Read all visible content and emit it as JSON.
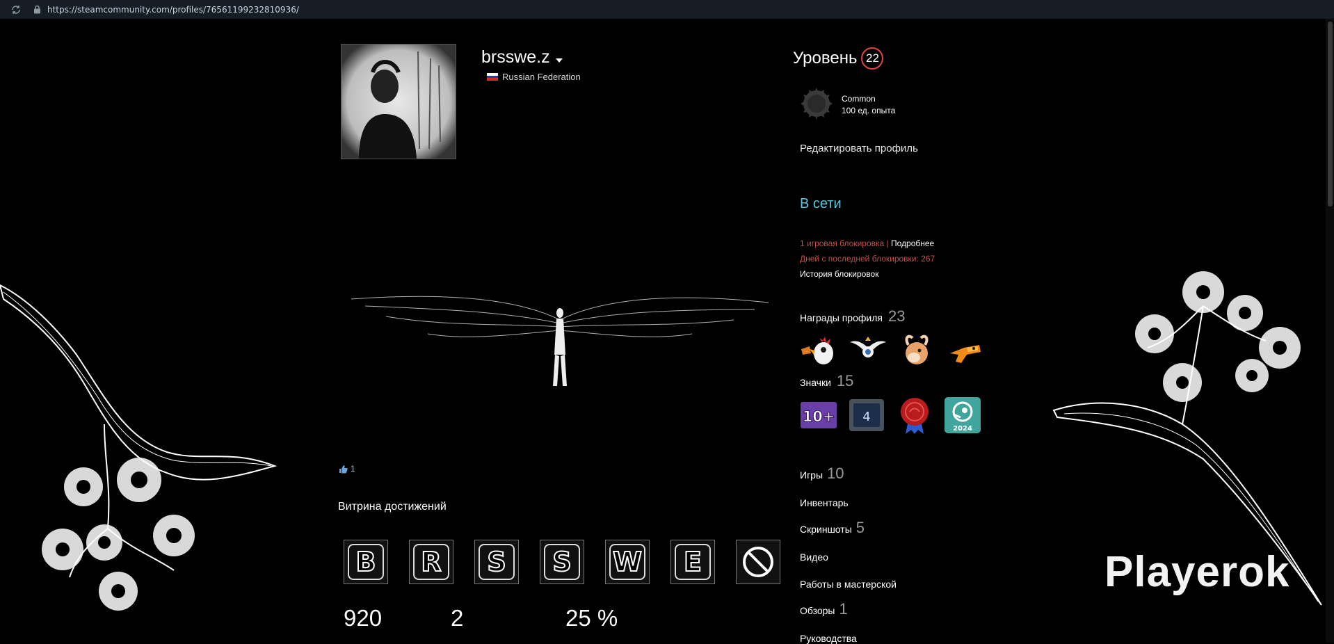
{
  "browser": {
    "url": "https://steamcommunity.com/profiles/76561199232810936/"
  },
  "profile": {
    "persona_name": "brsswe.z",
    "country": "Russian Federation"
  },
  "showcase": {
    "likes": "1",
    "title": "Витрина достижений",
    "letters": [
      "B",
      "R",
      "S",
      "S",
      "W",
      "E"
    ],
    "stats": [
      "920",
      "2",
      "25 %"
    ]
  },
  "sidebar": {
    "level_label": "Уровень",
    "level_value": "22",
    "xp_badge_name": "Common",
    "xp_badge_points": "100 ед. опыта",
    "edit_profile": "Редактировать профиль",
    "status": "В сети",
    "ban_count": "1 игровая блокировка",
    "ban_sep": " | ",
    "ban_more": "Подробнее",
    "days_since_ban": "Дней с последней блокировки: 267",
    "ban_history": "История блокировок",
    "awards_label": "Награды профиля",
    "awards_count": "23",
    "badges_label": "Значки",
    "badges_count": "15",
    "badge_tile_text": "10+",
    "badge_screen_text": "4",
    "badge_year_text": "2024",
    "links": {
      "games": "Игры",
      "games_count": "10",
      "inventory": "Инвентарь",
      "screenshots": "Скриншоты",
      "screenshots_count": "5",
      "videos": "Видео",
      "workshop": "Работы в мастерской",
      "reviews": "Обзоры",
      "reviews_count": "1",
      "guides": "Руководства"
    }
  },
  "overlay": {
    "brand": "Playerok"
  },
  "colors": {
    "accent_online": "#57cbde",
    "ban_red": "#c0504a",
    "level_ring": "#e0453d",
    "urlbar_bg": "#171d25"
  }
}
